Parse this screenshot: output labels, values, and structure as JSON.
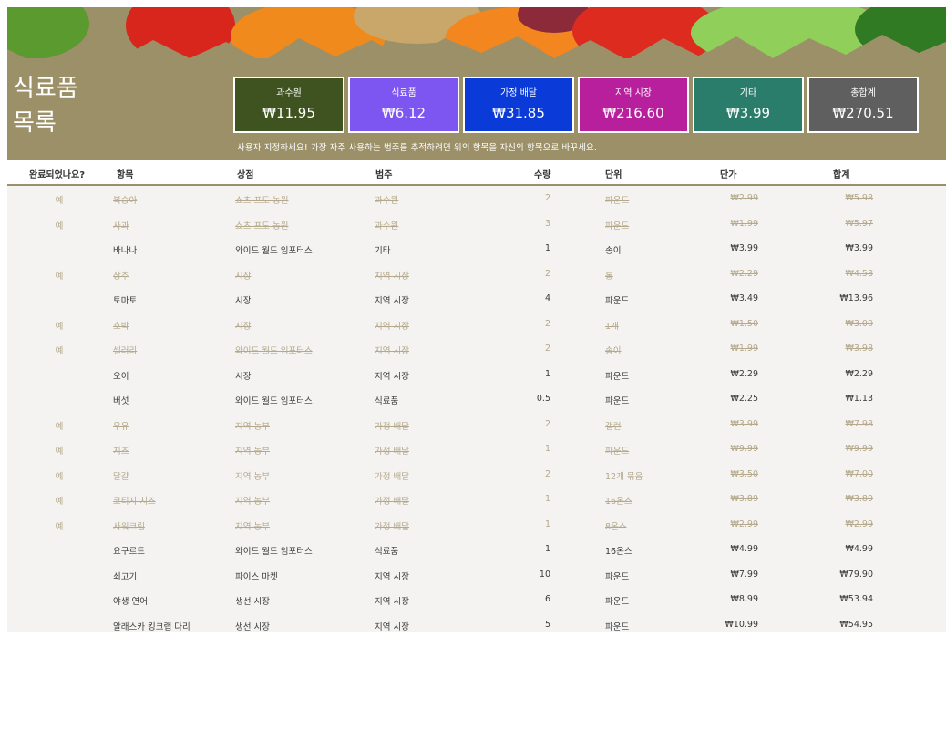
{
  "sheet": {
    "title_lines": [
      "식료품",
      "목록"
    ],
    "hint": "사용자 지정하세요! 가장 자주 사용하는 범주를 추적하려면 위의 항목을 자신의 항목으로 바꾸세요."
  },
  "categories": [
    {
      "label": "과수원",
      "value": "₩11.95",
      "color": "#3f5320"
    },
    {
      "label": "식료품",
      "value": "₩6.12",
      "color": "#7d55f0"
    },
    {
      "label": "가정 배달",
      "value": "₩31.85",
      "color": "#0a3bd8"
    },
    {
      "label": "지역 시장",
      "value": "₩216.60",
      "color": "#b81f9c"
    },
    {
      "label": "기타",
      "value": "₩3.99",
      "color": "#2a7c6b"
    },
    {
      "label": "총합계",
      "value": "₩270.51",
      "color": "#5f5f5f"
    }
  ],
  "table": {
    "headers": {
      "done": "완료되었나요?",
      "item": "항목",
      "store": "상점",
      "category": "범주",
      "qty": "수량",
      "unit": "단위",
      "price": "단가",
      "total": "합계"
    },
    "rows": [
      {
        "done": "예",
        "item": "복숭아",
        "store": "쇼츠 프도 농원",
        "category": "과수원",
        "qty": "2",
        "unit": "파운드",
        "price": "₩2.99",
        "total": "₩5.98"
      },
      {
        "done": "예",
        "item": "사과",
        "store": "쇼츠 프도 농원",
        "category": "과수원",
        "qty": "3",
        "unit": "파운드",
        "price": "₩1.99",
        "total": "₩5.97"
      },
      {
        "done": "",
        "item": "바나나",
        "store": "와이드 월드 임포터스",
        "category": "기타",
        "qty": "1",
        "unit": "송이",
        "price": "₩3.99",
        "total": "₩3.99"
      },
      {
        "done": "예",
        "item": "상추",
        "store": "시장",
        "category": "지역 시장",
        "qty": "2",
        "unit": "통",
        "price": "₩2.29",
        "total": "₩4.58"
      },
      {
        "done": "",
        "item": "토마토",
        "store": "시장",
        "category": "지역 시장",
        "qty": "4",
        "unit": "파운드",
        "price": "₩3.49",
        "total": "₩13.96"
      },
      {
        "done": "예",
        "item": "호박",
        "store": "시장",
        "category": "지역 시장",
        "qty": "2",
        "unit": "1개",
        "price": "₩1.50",
        "total": "₩3.00"
      },
      {
        "done": "예",
        "item": "셀러리",
        "store": "와이드 월드 임포터스",
        "category": "지역 시장",
        "qty": "2",
        "unit": "송이",
        "price": "₩1.99",
        "total": "₩3.98"
      },
      {
        "done": "",
        "item": "오이",
        "store": "시장",
        "category": "지역 시장",
        "qty": "1",
        "unit": "파운드",
        "price": "₩2.29",
        "total": "₩2.29"
      },
      {
        "done": "",
        "item": "버섯",
        "store": "와이드 월드 임포터스",
        "category": "식료품",
        "qty": "0.5",
        "unit": "파운드",
        "price": "₩2.25",
        "total": "₩1.13"
      },
      {
        "done": "예",
        "item": "우유",
        "store": "지역 농부",
        "category": "가정 배달",
        "qty": "2",
        "unit": "갤런",
        "price": "₩3.99",
        "total": "₩7.98"
      },
      {
        "done": "예",
        "item": "치즈",
        "store": "지역 농부",
        "category": "가정 배달",
        "qty": "1",
        "unit": "파운드",
        "price": "₩9.99",
        "total": "₩9.99"
      },
      {
        "done": "예",
        "item": "달걀",
        "store": "지역 농부",
        "category": "가정 배달",
        "qty": "2",
        "unit": "12개 묶음",
        "price": "₩3.50",
        "total": "₩7.00"
      },
      {
        "done": "예",
        "item": "코티지 치즈",
        "store": "지역 농부",
        "category": "가정 배달",
        "qty": "1",
        "unit": "16온스",
        "price": "₩3.89",
        "total": "₩3.89"
      },
      {
        "done": "예",
        "item": "사워크림",
        "store": "지역 농부",
        "category": "가정 배달",
        "qty": "1",
        "unit": "8온스",
        "price": "₩2.99",
        "total": "₩2.99"
      },
      {
        "done": "",
        "item": "요구르트",
        "store": "와이드 월드 임포터스",
        "category": "식료품",
        "qty": "1",
        "unit": "16온스",
        "price": "₩4.99",
        "total": "₩4.99"
      },
      {
        "done": "",
        "item": "쇠고기",
        "store": "파이스 마켓",
        "category": "지역 시장",
        "qty": "10",
        "unit": "파운드",
        "price": "₩7.99",
        "total": "₩79.90"
      },
      {
        "done": "",
        "item": "야생 연어",
        "store": "생선 시장",
        "category": "지역 시장",
        "qty": "6",
        "unit": "파운드",
        "price": "₩8.99",
        "total": "₩53.94"
      },
      {
        "done": "",
        "item": "알래스카 킹크랩 다리",
        "store": "생선 시장",
        "category": "지역 시장",
        "qty": "5",
        "unit": "파운드",
        "price": "₩10.99",
        "total": "₩54.95"
      }
    ]
  }
}
